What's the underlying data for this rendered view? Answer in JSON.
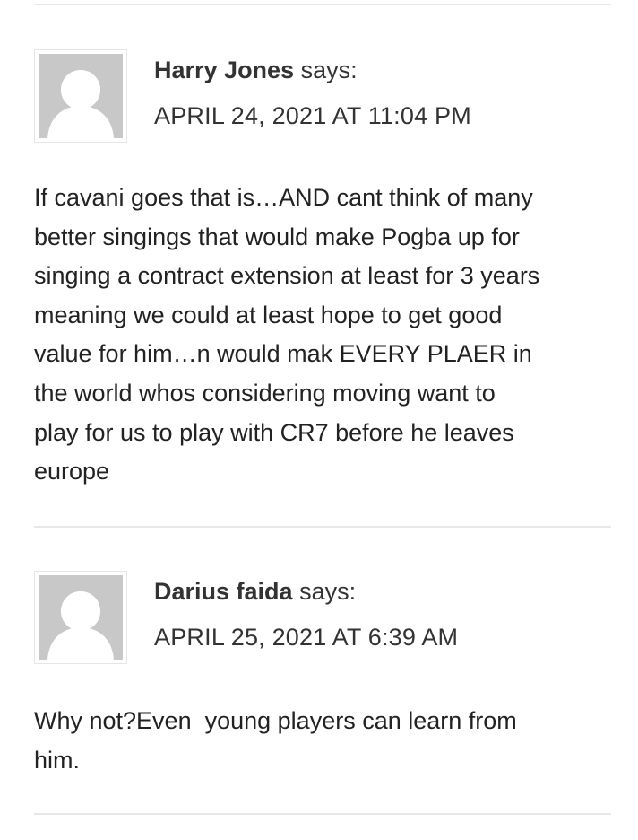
{
  "comments": [
    {
      "author": "Harry Jones",
      "says_label": " says:",
      "date": "APRIL 24, 2021 AT 11:04 PM",
      "avatar_icon": "default-avatar-icon",
      "body_lines": [
        "If cavani goes that is…AND cant think of many",
        "better singings that would make Pogba up for",
        "singing a contract extension at least for 3 years",
        "meaning we could at least hope to get good",
        "value for him…n would mak EVERY PLAER in",
        "the world whos considering moving want to",
        "play for us to play with CR7 before he leaves",
        "europe"
      ]
    },
    {
      "author": "Darius faida",
      "says_label": " says:",
      "date": "APRIL 25, 2021 AT 6:39 AM",
      "avatar_icon": "default-avatar-icon",
      "body_lines": [
        "Why not?Even  young players can learn from",
        "him."
      ]
    }
  ],
  "colors": {
    "avatar_bg": "#c8c8c8",
    "avatar_figure": "#ffffff",
    "divider": "#e8e8e8",
    "text": "#222222"
  }
}
